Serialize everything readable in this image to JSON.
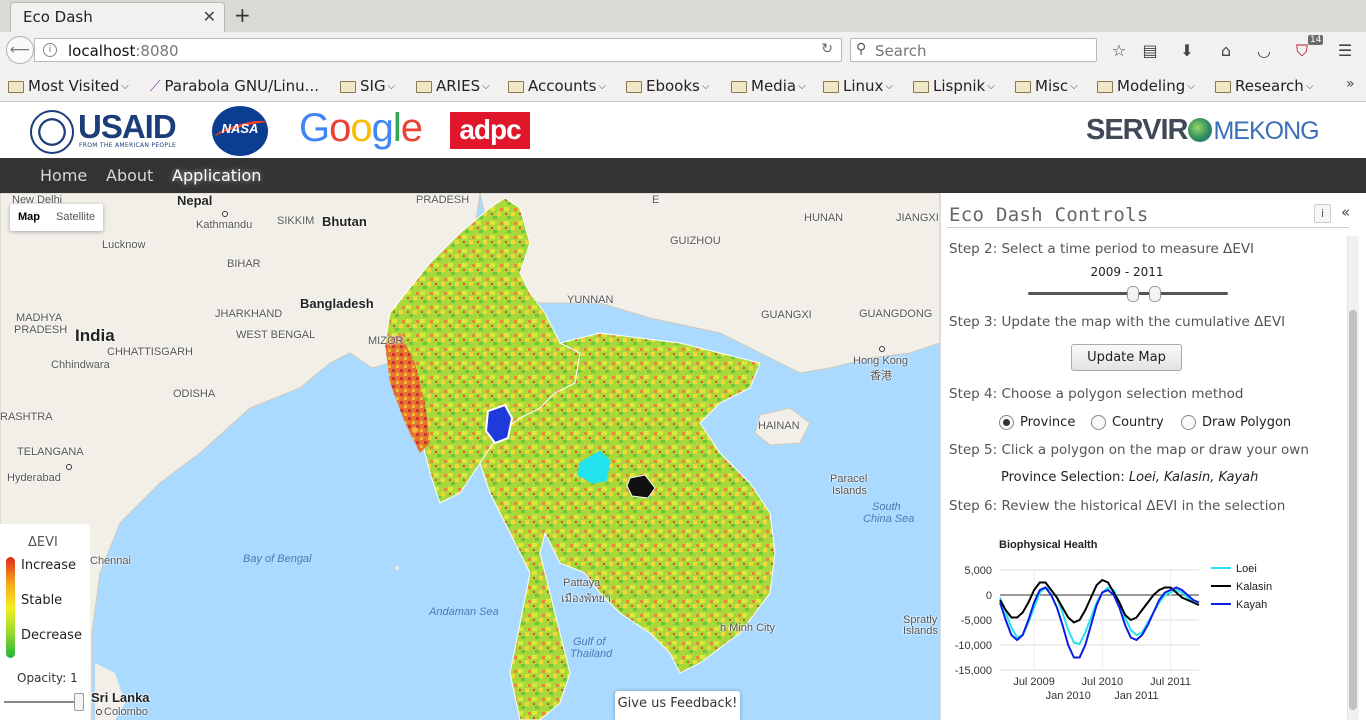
{
  "browser": {
    "tab_title": "Eco Dash",
    "url_host": "localhost",
    "url_port": ":8080",
    "search_placeholder": "Search",
    "extension_badge": "14",
    "bookmarks": [
      {
        "label": "Most Visited",
        "type": "special"
      },
      {
        "label": "Parabola GNU/Linu...",
        "type": "link"
      },
      {
        "label": "SIG",
        "type": "folder"
      },
      {
        "label": "ARIES",
        "type": "folder"
      },
      {
        "label": "Accounts",
        "type": "folder"
      },
      {
        "label": "Ebooks",
        "type": "folder"
      },
      {
        "label": "Media",
        "type": "folder"
      },
      {
        "label": "Linux",
        "type": "folder"
      },
      {
        "label": "Lispnik",
        "type": "folder"
      },
      {
        "label": "Misc",
        "type": "folder"
      },
      {
        "label": "Modeling",
        "type": "folder"
      },
      {
        "label": "Research",
        "type": "folder"
      }
    ]
  },
  "logos": {
    "usaid": "USAID",
    "usaid_sub": "FROM THE AMERICAN PEOPLE",
    "nasa": "NASA",
    "google": "Google",
    "adpc": "adpc",
    "servir": "SERVIR",
    "servir_region": "MEKONG"
  },
  "nav": {
    "home": "Home",
    "about": "About",
    "application": "Application"
  },
  "map": {
    "type_map": "Map",
    "type_satellite": "Satellite",
    "labels": {
      "new_delhi": "New Delhi",
      "nepal": "Nepal",
      "kathmandu": "Kathmandu",
      "sikkim": "SIKKIM",
      "bhutan": "Bhutan",
      "pradesh_n": "PRADESH",
      "sichuan_e": "E",
      "guizhou": "GUIZHOU",
      "hunan": "HUNAN",
      "jiangxi": "JIANGXI",
      "lucknow": "Lucknow",
      "bihar": "BIHAR",
      "bangladesh": "Bangladesh",
      "yunnan": "YUNNAN",
      "india": "India",
      "madhya": "MADHYA",
      "pradesh_w": "PRADESH",
      "jharkhand": "JHARKHAND",
      "west_bengal": "WEST BENGAL",
      "mizor": "MIZOR",
      "guangxi": "GUANGXI",
      "guangdong": "GUANGDONG",
      "chhattisgarh": "CHHATTISGARH",
      "chhindwara": "Chhindwara",
      "hong_kong": "Hong Kong",
      "hong_kong_cn": "香港",
      "odisha": "ODISHA",
      "rashtra": "RASHTRA",
      "hainan": "HAINAN",
      "telangana": "TELANGANA",
      "hyderabad": "Hyderabad",
      "paracel": "Paracel",
      "islands": "Islands",
      "bay_of_bengal": "Bay of Bengal",
      "south_china_sea_1": "South",
      "south_china_sea_2": "China Sea",
      "chennai": "Chennai",
      "pattaya": "Pattaya",
      "pattaya_th": "เมืองพัทยา",
      "andaman_sea": "Andaman Sea",
      "gulf_of": "Gulf of",
      "thailand": "Thailand",
      "hcm_city": "h Minh City",
      "spratly": "Spratly",
      "spratly_islands": "Islands",
      "sri_lanka": "Sri Lanka",
      "colombo": "Colombo"
    },
    "legend": {
      "title": "ΔEVI",
      "increase": "Increase",
      "stable": "Stable",
      "decrease": "Decrease",
      "opacity": "Opacity: 1"
    },
    "feedback": "Give us Feedback!"
  },
  "controls": {
    "title": "Eco Dash Controls",
    "info": "i",
    "collapse": "«",
    "step2": "Step 2: Select a time period to measure ΔEVI",
    "period": "2009 - 2011",
    "step3": "Step 3: Update the map with the cumulative ΔEVI",
    "update_button": "Update Map",
    "step4": "Step 4: Choose a polygon selection method",
    "radio_province": "Province",
    "radio_country": "Country",
    "radio_draw": "Draw Polygon",
    "radio_selected": "Province",
    "step5": "Step 5: Click a polygon on the map or draw your own",
    "selection_label": "Province Selection:",
    "selection_value": "Loei, Kalasin, Kayah",
    "step6": "Step 6: Review the historical ΔEVI in the selection"
  },
  "chart_data": {
    "type": "line",
    "title": "Biophysical Health",
    "xlabel": "",
    "ylabel": "",
    "x_ticks_top": [
      "Jul 2009",
      "Jul 2010",
      "Jul 2011"
    ],
    "x_ticks_bottom": [
      "Jan 2010",
      "Jan 2011"
    ],
    "y_ticks": [
      "5,000",
      "0",
      "-5,000",
      "-10,000",
      "-15,000"
    ],
    "ylim": [
      -15000,
      5000
    ],
    "x_dates": [
      "2009-01",
      "2009-02",
      "2009-03",
      "2009-04",
      "2009-05",
      "2009-06",
      "2009-07",
      "2009-08",
      "2009-09",
      "2009-10",
      "2009-11",
      "2009-12",
      "2010-01",
      "2010-02",
      "2010-03",
      "2010-04",
      "2010-05",
      "2010-06",
      "2010-07",
      "2010-08",
      "2010-09",
      "2010-10",
      "2010-11",
      "2010-12",
      "2011-01",
      "2011-02",
      "2011-03",
      "2011-04",
      "2011-05",
      "2011-06",
      "2011-07",
      "2011-08",
      "2011-09",
      "2011-10",
      "2011-11",
      "2011-12"
    ],
    "series": [
      {
        "name": "Loei",
        "color": "#22e3ee",
        "values": [
          -500,
          -3500,
          -6500,
          -8500,
          -8000,
          -5500,
          -2500,
          500,
          1500,
          1000,
          -500,
          -3500,
          -7000,
          -9500,
          -9800,
          -7500,
          -4500,
          -1500,
          500,
          1500,
          1000,
          -1500,
          -4500,
          -7000,
          -8000,
          -7500,
          -5500,
          -3500,
          -1500,
          0,
          500,
          1000,
          500,
          -500,
          -1500,
          -2000
        ]
      },
      {
        "name": "Kalasin",
        "color": "#000000",
        "values": [
          -1000,
          -3000,
          -4500,
          -4500,
          -3500,
          -1500,
          1000,
          2500,
          2500,
          1000,
          -500,
          -2500,
          -4500,
          -5500,
          -5000,
          -3000,
          -500,
          2000,
          3000,
          2500,
          500,
          -1500,
          -4000,
          -5000,
          -4500,
          -3000,
          -1500,
          0,
          1000,
          1500,
          1500,
          500,
          -500,
          -1000,
          -1500,
          -2000
        ]
      },
      {
        "name": "Kayah",
        "color": "#0b1de0",
        "values": [
          -1500,
          -5000,
          -8000,
          -9000,
          -8000,
          -5000,
          -1500,
          1000,
          1500,
          0,
          -2500,
          -6000,
          -10000,
          -12500,
          -12500,
          -10000,
          -6000,
          -2000,
          500,
          1000,
          0,
          -2500,
          -6000,
          -8500,
          -9000,
          -8000,
          -6000,
          -3500,
          -1000,
          500,
          1000,
          1500,
          1000,
          0,
          -1000,
          -1500
        ]
      }
    ],
    "legend_position": "right"
  }
}
